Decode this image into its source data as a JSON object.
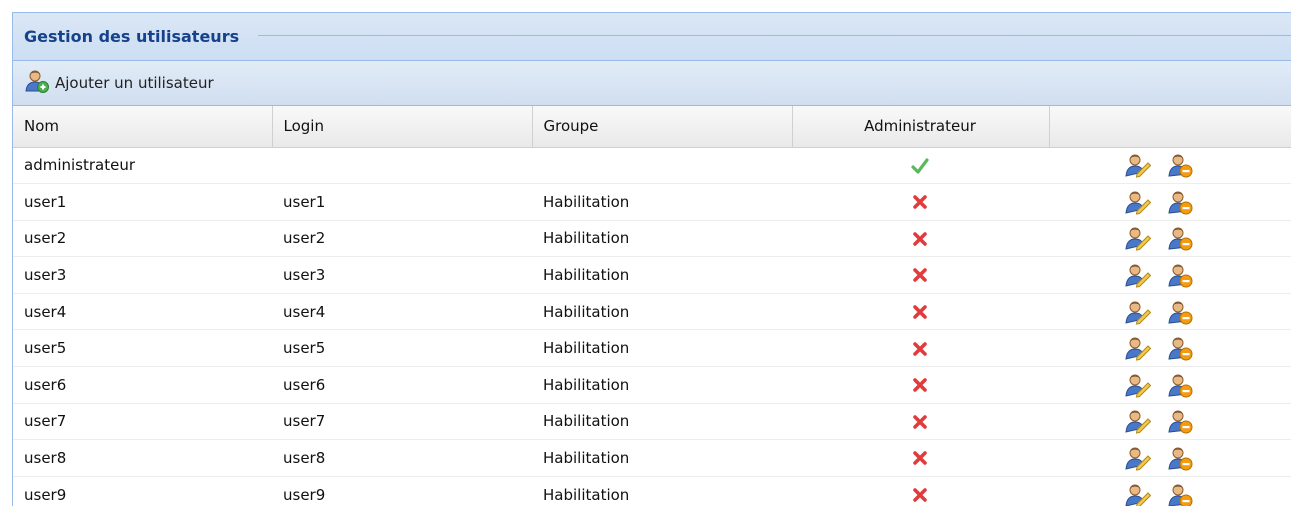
{
  "panel": {
    "title": "Gestion des utilisateurs"
  },
  "toolbar": {
    "add_user_label": "Ajouter un utilisateur",
    "add_user_icon": "user-add-icon"
  },
  "table": {
    "columns": [
      "Nom",
      "Login",
      "Groupe",
      "Administrateur",
      ""
    ],
    "rows": [
      {
        "nom": "administrateur",
        "login": "",
        "groupe": "",
        "admin": true
      },
      {
        "nom": "user1",
        "login": "user1",
        "groupe": "Habilitation",
        "admin": false
      },
      {
        "nom": "user2",
        "login": "user2",
        "groupe": "Habilitation",
        "admin": false
      },
      {
        "nom": "user3",
        "login": "user3",
        "groupe": "Habilitation",
        "admin": false
      },
      {
        "nom": "user4",
        "login": "user4",
        "groupe": "Habilitation",
        "admin": false
      },
      {
        "nom": "user5",
        "login": "user5",
        "groupe": "Habilitation",
        "admin": false
      },
      {
        "nom": "user6",
        "login": "user6",
        "groupe": "Habilitation",
        "admin": false
      },
      {
        "nom": "user7",
        "login": "user7",
        "groupe": "Habilitation",
        "admin": false
      },
      {
        "nom": "user8",
        "login": "user8",
        "groupe": "Habilitation",
        "admin": false
      },
      {
        "nom": "user9",
        "login": "user9",
        "groupe": "Habilitation",
        "admin": false
      }
    ],
    "row_actions": [
      "edit-user-icon",
      "delete-user-icon"
    ]
  },
  "colors": {
    "header_text": "#15428b",
    "border": "#99bbe8",
    "check": "#5cb85c",
    "cross": "#e23b3b"
  }
}
